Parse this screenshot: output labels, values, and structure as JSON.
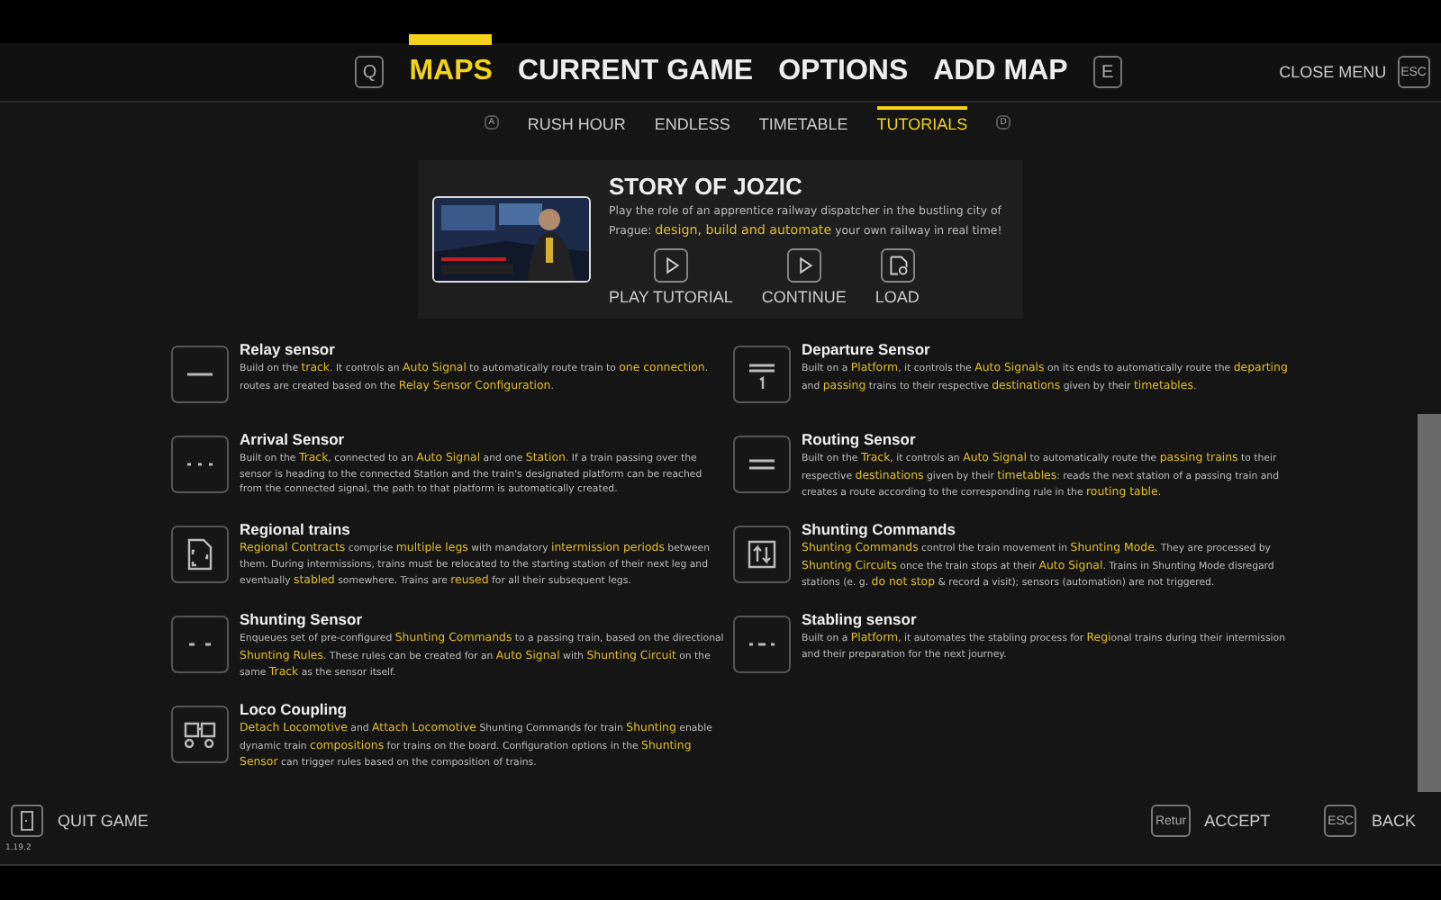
{
  "main_tabs": {
    "prev_key": "Q",
    "next_key": "E",
    "tabs": [
      {
        "label": "MAPS",
        "selected": true
      },
      {
        "label": "CURRENT GAME",
        "selected": false
      },
      {
        "label": "OPTIONS",
        "selected": false
      },
      {
        "label": "ADD MAP",
        "selected": false
      }
    ]
  },
  "close_menu": {
    "label": "CLOSE MENU",
    "key": "ESC"
  },
  "sub_tabs": {
    "prev_key": "A",
    "next_key": "D",
    "tabs": [
      {
        "label": "RUSH HOUR",
        "selected": false
      },
      {
        "label": "ENDLESS",
        "selected": false
      },
      {
        "label": "TIMETABLE",
        "selected": false
      },
      {
        "label": "TUTORIALS",
        "selected": true
      }
    ]
  },
  "story": {
    "kind": "picture",
    "title": "STORY OF JOZIC",
    "description": "Play the role of an apprentice railway dispatcher in the bustling city of Prague: **design, build and automate** your own railway in real time!",
    "actions": [
      {
        "kind": "play",
        "label": "PLAY TUTORIAL"
      },
      {
        "kind": "play",
        "label": "CONTINUE"
      },
      {
        "kind": "load",
        "label": "LOAD"
      }
    ]
  },
  "left_entries": [
    {
      "kind": "dash",
      "title": "Relay sensor",
      "text": "Build on the **track**. It controls an **Auto Signal** to automatically route train to **one connection**. routes are created based on the **Relay Sensor Configuration**."
    },
    {
      "kind": "dots",
      "title": "Arrival Sensor",
      "text": "Built on the **Track**, connected to an **Auto Signal** and one **Station**. If a train passing over the sensor is heading to the connected Station and the train's designated platform can be reached from the connected signal, the path to that platform is automatically created."
    },
    {
      "kind": "document",
      "title": "Regional trains",
      "text": "**Regional Contracts** comprise **multiple legs** with mandatory **intermission periods** between them. During intermissions, trains must be relocated to the starting station of their next leg and eventually **stabled** somewhere. Trains are **reused** for all their subsequent legs."
    },
    {
      "kind": "pair",
      "title": "Shunting Sensor",
      "text": "Enqueues set of pre-configured **Shunting Commands** to a passing train, based on the directional **Shunting Rules**. These rules can be created for an **Auto Signal** with **Shunting Circuit** on the same **Track** as the sensor itself."
    },
    {
      "kind": "coupling",
      "title": "Loco Coupling",
      "text": "**Detach Locomotive** and **Attach Locomotive** Shunting Commands for train **Shunting** enable dynamic train **compositions** for trains on the board. Configuration options in the **Shunting Sensor** can trigger rules based on the composition of trains."
    }
  ],
  "right_entries": [
    {
      "kind": "departure",
      "title": "Departure Sensor",
      "text": "Built on a **Platform**, it controls the **Auto Signals** on its ends to automatically route the **departing** and **passing** trains to their respective **destinations** given by their **timetables**."
    },
    {
      "kind": "lines",
      "title": "Routing Sensor",
      "text": "Built on the **Track**, it controls an **Auto Signal** to automatically route the **passing trains** to their respective **destinations** given by their **timetables**: reads the next station of a passing train and creates a route according to the corresponding rule in the **routing table**."
    },
    {
      "kind": "arrows",
      "title": "Shunting Commands",
      "text": "**Shunting Commands** control the train movement in **Shunting Mode**. They are processed by **Shunting Circuits** once the train stops at their **Auto Signal**. Trains in Shunting Mode disregard stations (e. g. **do not stop** & record a visit); sensors (automation) are not triggered."
    },
    {
      "kind": "dotdash",
      "title": "Stabling sensor",
      "text": "Built on a **Platform**, it automates the stabling process for **Regi**onal trains during their intermission and their preparation for the next journey."
    }
  ],
  "footer": {
    "quit": {
      "label": "QUIT GAME"
    },
    "accept": {
      "key": "Retur",
      "label": "ACCEPT"
    },
    "back": {
      "key": "ESC",
      "label": "BACK"
    },
    "version": "1.19.2"
  }
}
